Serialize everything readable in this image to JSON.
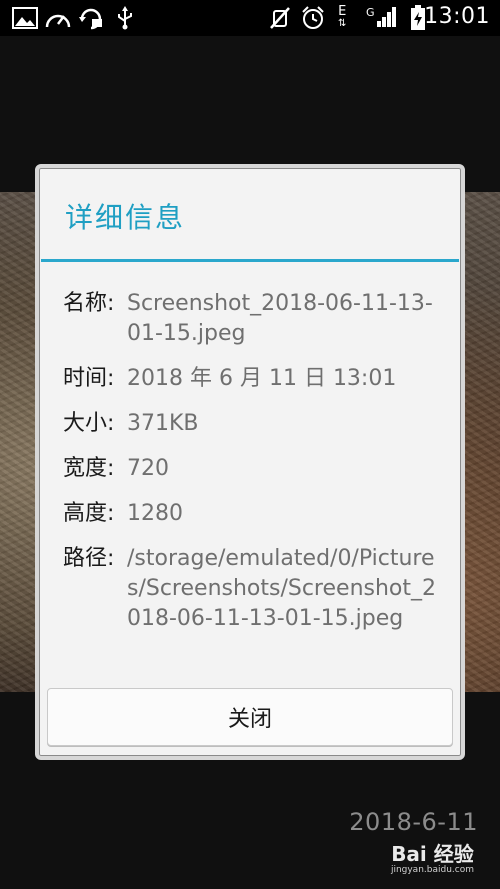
{
  "status_bar": {
    "time": "13:01",
    "icons": [
      "image-icon",
      "speedometer-icon",
      "sync-icon",
      "usb-icon",
      "mute-icon",
      "alarm-icon",
      "data-e-icon",
      "signal-icon",
      "battery-charging-icon"
    ],
    "network_e": "E",
    "network_g": "G"
  },
  "dialog": {
    "title": "详细信息",
    "rows": [
      {
        "label": "名称:",
        "value": "Screenshot_2018-06-11-13-01-15.jpeg"
      },
      {
        "label": "时间:",
        "value": "2018 年 6 月 11 日 13:01"
      },
      {
        "label": "大小:",
        "value": "371KB"
      },
      {
        "label": "宽度:",
        "value": "720"
      },
      {
        "label": "高度:",
        "value": "1280"
      },
      {
        "label": "路径:",
        "value": "/storage/emulated/0/Pictures/Screenshots/Screenshot_2018-06-11-13-01-15.jpeg"
      }
    ],
    "close_label": "关闭"
  },
  "photo_date_stamp": "2018-6-11",
  "watermark": {
    "brand": "Bai 经验",
    "url": "jingyan.baidu.com"
  },
  "colors": {
    "accent": "#1f9fc3",
    "dialog_background": "#f3f3f3",
    "value_text": "#6f6f6f"
  }
}
